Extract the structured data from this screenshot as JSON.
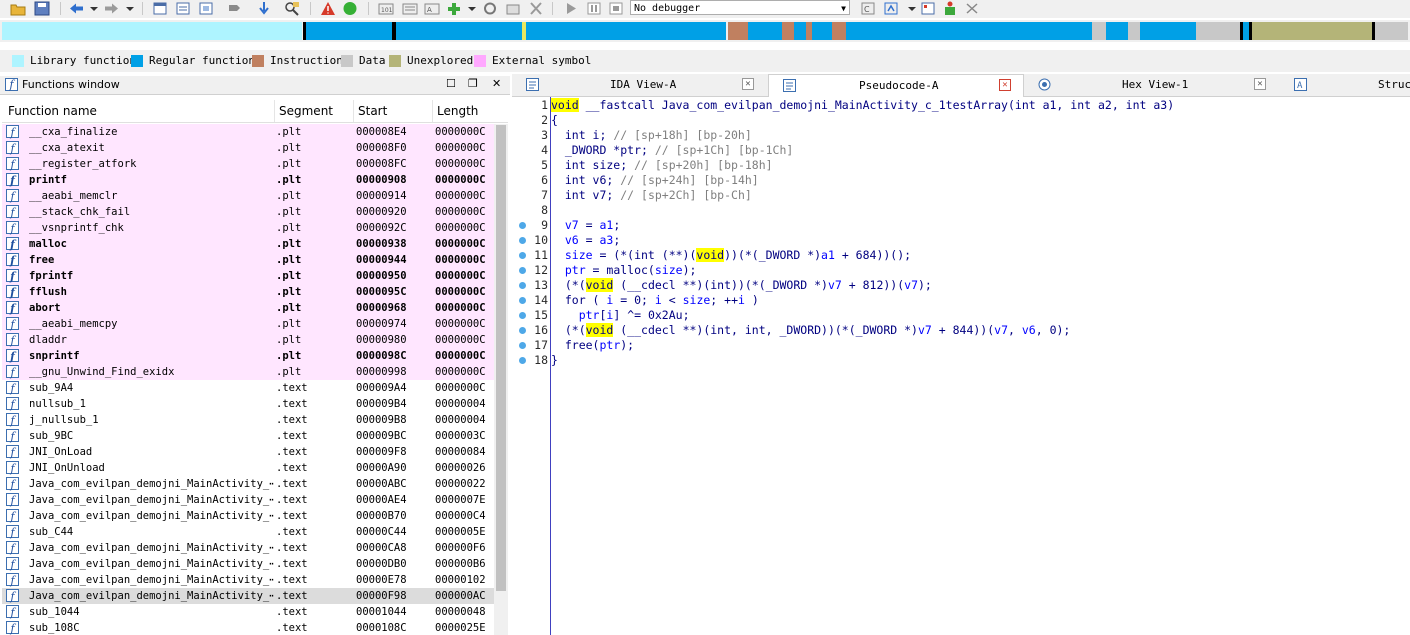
{
  "toolbar": {
    "debugger_value": "No debugger",
    "icons": [
      "open-icon",
      "save-icon",
      "back-icon",
      "back-dropdown-icon",
      "forward-icon",
      "forward-dropdown-icon",
      "new-window-icon",
      "list-icon",
      "struct-icon",
      "xref-icon",
      "jump-icon",
      "search-icon",
      "error-icon",
      "run-icon",
      "code-icon",
      "data-icon",
      "abc-icon",
      "add-icon",
      "patch-icon",
      "graph-icon",
      "clear-icon",
      "start-icon",
      "pause-icon",
      "stop-icon",
      "debugger-select",
      "cpu-icon",
      "step-icon",
      "attach-icon",
      "window-icon",
      "trace-icon"
    ]
  },
  "legend": {
    "items": [
      {
        "label": "Library function",
        "color": "#aef4ff"
      },
      {
        "label": "Regular function",
        "color": "#00a0e6"
      },
      {
        "label": "Instruction",
        "color": "#c08060"
      },
      {
        "label": "Data",
        "color": "#c8c8c8"
      },
      {
        "label": "Unexplored",
        "color": "#b4b478"
      },
      {
        "label": "External symbol",
        "color": "#ffa8ff"
      }
    ]
  },
  "functions_window": {
    "title": "Functions window",
    "columns": {
      "name": "Function name",
      "segment": "Segment",
      "start": "Start",
      "length": "Length"
    },
    "rows": [
      {
        "name": "__cxa_finalize",
        "segment": ".plt",
        "start": "000008E4",
        "length": "0000000C",
        "style": "pink"
      },
      {
        "name": "__cxa_atexit",
        "segment": ".plt",
        "start": "000008F0",
        "length": "0000000C",
        "style": "pink"
      },
      {
        "name": "__register_atfork",
        "segment": ".plt",
        "start": "000008FC",
        "length": "0000000C",
        "style": "pink"
      },
      {
        "name": "printf",
        "segment": ".plt",
        "start": "00000908",
        "length": "0000000C",
        "style": "pink-bold"
      },
      {
        "name": "__aeabi_memclr",
        "segment": ".plt",
        "start": "00000914",
        "length": "0000000C",
        "style": "pink"
      },
      {
        "name": "__stack_chk_fail",
        "segment": ".plt",
        "start": "00000920",
        "length": "0000000C",
        "style": "pink"
      },
      {
        "name": "__vsnprintf_chk",
        "segment": ".plt",
        "start": "0000092C",
        "length": "0000000C",
        "style": "pink"
      },
      {
        "name": "malloc",
        "segment": ".plt",
        "start": "00000938",
        "length": "0000000C",
        "style": "pink-bold"
      },
      {
        "name": "free",
        "segment": ".plt",
        "start": "00000944",
        "length": "0000000C",
        "style": "pink-bold"
      },
      {
        "name": "fprintf",
        "segment": ".plt",
        "start": "00000950",
        "length": "0000000C",
        "style": "pink-bold"
      },
      {
        "name": "fflush",
        "segment": ".plt",
        "start": "0000095C",
        "length": "0000000C",
        "style": "pink-bold"
      },
      {
        "name": "abort",
        "segment": ".plt",
        "start": "00000968",
        "length": "0000000C",
        "style": "pink-bold"
      },
      {
        "name": "__aeabi_memcpy",
        "segment": ".plt",
        "start": "00000974",
        "length": "0000000C",
        "style": "pink"
      },
      {
        "name": "dladdr",
        "segment": ".plt",
        "start": "00000980",
        "length": "0000000C",
        "style": "pink"
      },
      {
        "name": "snprintf",
        "segment": ".plt",
        "start": "0000098C",
        "length": "0000000C",
        "style": "pink-bold"
      },
      {
        "name": "__gnu_Unwind_Find_exidx",
        "segment": ".plt",
        "start": "00000998",
        "length": "0000000C",
        "style": "pink"
      },
      {
        "name": "sub_9A4",
        "segment": ".text",
        "start": "000009A4",
        "length": "0000000C",
        "style": "normal"
      },
      {
        "name": "nullsub_1",
        "segment": ".text",
        "start": "000009B4",
        "length": "00000004",
        "style": "normal"
      },
      {
        "name": "j_nullsub_1",
        "segment": ".text",
        "start": "000009B8",
        "length": "00000004",
        "style": "normal"
      },
      {
        "name": "sub_9BC",
        "segment": ".text",
        "start": "000009BC",
        "length": "0000003C",
        "style": "normal"
      },
      {
        "name": "JNI_OnLoad",
        "segment": ".text",
        "start": "000009F8",
        "length": "00000084",
        "style": "normal"
      },
      {
        "name": "JNI_OnUnload",
        "segment": ".text",
        "start": "00000A90",
        "length": "00000026",
        "style": "normal"
      },
      {
        "name": "Java_com_evilpan_demojni_MainActivity_⋯",
        "segment": ".text",
        "start": "00000ABC",
        "length": "00000022",
        "style": "normal"
      },
      {
        "name": "Java_com_evilpan_demojni_MainActivity_⋯",
        "segment": ".text",
        "start": "00000AE4",
        "length": "0000007E",
        "style": "normal"
      },
      {
        "name": "Java_com_evilpan_demojni_MainActivity_⋯",
        "segment": ".text",
        "start": "00000B70",
        "length": "000000C4",
        "style": "normal"
      },
      {
        "name": "sub_C44",
        "segment": ".text",
        "start": "00000C44",
        "length": "0000005E",
        "style": "normal"
      },
      {
        "name": "Java_com_evilpan_demojni_MainActivity_⋯",
        "segment": ".text",
        "start": "00000CA8",
        "length": "000000F6",
        "style": "normal"
      },
      {
        "name": "Java_com_evilpan_demojni_MainActivity_⋯",
        "segment": ".text",
        "start": "00000DB0",
        "length": "000000B6",
        "style": "normal"
      },
      {
        "name": "Java_com_evilpan_demojni_MainActivity_⋯",
        "segment": ".text",
        "start": "00000E78",
        "length": "00000102",
        "style": "normal"
      },
      {
        "name": "Java_com_evilpan_demojni_MainActivity_⋯",
        "segment": ".text",
        "start": "00000F98",
        "length": "000000AC",
        "style": "selected"
      },
      {
        "name": "sub_1044",
        "segment": ".text",
        "start": "00001044",
        "length": "00000048",
        "style": "normal"
      },
      {
        "name": "sub_108C",
        "segment": ".text",
        "start": "0000108C",
        "length": "0000025E",
        "style": "normal"
      }
    ]
  },
  "tabs": [
    {
      "label": "IDA View-A",
      "icon": "ida-view-icon",
      "active": false
    },
    {
      "label": "Pseudocode-A",
      "icon": "pseudocode-icon",
      "active": true
    },
    {
      "label": "Hex View-1",
      "icon": "hex-view-icon",
      "active": false
    },
    {
      "label": "Struct",
      "icon": "struct-view-icon",
      "active": false
    }
  ],
  "pseudocode": {
    "lines": [
      {
        "n": "1",
        "dot": false,
        "tokens": [
          [
            "hl kw",
            "void"
          ],
          [
            "kw",
            " __fastcall Java_com_evilpan_demojni_MainActivity_c_1testArray(int a1, int a2, int a3)"
          ]
        ]
      },
      {
        "n": "2",
        "dot": false,
        "tokens": [
          [
            "kw",
            "{"
          ]
        ]
      },
      {
        "n": "3",
        "dot": false,
        "tokens": [
          [
            "kw",
            "  int i; "
          ],
          [
            "cmt",
            "// [sp+18h] [bp-20h]"
          ]
        ]
      },
      {
        "n": "4",
        "dot": false,
        "tokens": [
          [
            "kw",
            "  _DWORD *ptr; "
          ],
          [
            "cmt",
            "// [sp+1Ch] [bp-1Ch]"
          ]
        ]
      },
      {
        "n": "5",
        "dot": false,
        "tokens": [
          [
            "kw",
            "  int size; "
          ],
          [
            "cmt",
            "// [sp+20h] [bp-18h]"
          ]
        ]
      },
      {
        "n": "6",
        "dot": false,
        "tokens": [
          [
            "kw",
            "  int v6; "
          ],
          [
            "cmt",
            "// [sp+24h] [bp-14h]"
          ]
        ]
      },
      {
        "n": "7",
        "dot": false,
        "tokens": [
          [
            "kw",
            "  int v7; "
          ],
          [
            "cmt",
            "// [sp+2Ch] [bp-Ch]"
          ]
        ]
      },
      {
        "n": "8",
        "dot": false,
        "tokens": []
      },
      {
        "n": "9",
        "dot": true,
        "tokens": [
          [
            "var",
            "  v7"
          ],
          [
            "kw",
            " = "
          ],
          [
            "var",
            "a1"
          ],
          [
            "kw",
            ";"
          ]
        ]
      },
      {
        "n": "10",
        "dot": true,
        "tokens": [
          [
            "var",
            "  v6"
          ],
          [
            "kw",
            " = "
          ],
          [
            "var",
            "a3"
          ],
          [
            "kw",
            ";"
          ]
        ]
      },
      {
        "n": "11",
        "dot": true,
        "tokens": [
          [
            "var",
            "  size"
          ],
          [
            "kw",
            " = (*(int (**)("
          ],
          [
            "hl kw",
            "void"
          ],
          [
            "kw",
            "))(*(_DWORD *)"
          ],
          [
            "var",
            "a1"
          ],
          [
            "kw",
            " + 684))();"
          ]
        ]
      },
      {
        "n": "12",
        "dot": true,
        "tokens": [
          [
            "var",
            "  ptr"
          ],
          [
            "kw",
            " = malloc("
          ],
          [
            "var",
            "size"
          ],
          [
            "kw",
            ");"
          ]
        ]
      },
      {
        "n": "13",
        "dot": true,
        "tokens": [
          [
            "kw",
            "  (*("
          ],
          [
            "hl kw",
            "void"
          ],
          [
            "kw",
            " (__cdecl **)(int))(*(_DWORD *)"
          ],
          [
            "var",
            "v7"
          ],
          [
            "kw",
            " + 812))("
          ],
          [
            "var",
            "v7"
          ],
          [
            "kw",
            ");"
          ]
        ]
      },
      {
        "n": "14",
        "dot": true,
        "tokens": [
          [
            "kw",
            "  for ( "
          ],
          [
            "var",
            "i"
          ],
          [
            "kw",
            " = 0; "
          ],
          [
            "var",
            "i"
          ],
          [
            "kw",
            " < "
          ],
          [
            "var",
            "size"
          ],
          [
            "kw",
            "; ++"
          ],
          [
            "var",
            "i"
          ],
          [
            "kw",
            " )"
          ]
        ]
      },
      {
        "n": "15",
        "dot": true,
        "tokens": [
          [
            "var",
            "    ptr"
          ],
          [
            "kw",
            "["
          ],
          [
            "var",
            "i"
          ],
          [
            "kw",
            "] ^= 0x2Au;"
          ]
        ]
      },
      {
        "n": "16",
        "dot": true,
        "tokens": [
          [
            "kw",
            "  (*("
          ],
          [
            "hl kw",
            "void"
          ],
          [
            "kw",
            " (__cdecl **)(int, int, _DWORD))(*(_DWORD *)"
          ],
          [
            "var",
            "v7"
          ],
          [
            "kw",
            " + 844))("
          ],
          [
            "var",
            "v7"
          ],
          [
            "kw",
            ", "
          ],
          [
            "var",
            "v6"
          ],
          [
            "kw",
            ", 0);"
          ]
        ]
      },
      {
        "n": "17",
        "dot": true,
        "tokens": [
          [
            "kw",
            "  free("
          ],
          [
            "var",
            "ptr"
          ],
          [
            "kw",
            ");"
          ]
        ]
      },
      {
        "n": "18",
        "dot": true,
        "tokens": [
          [
            "kw",
            "}"
          ]
        ]
      }
    ]
  }
}
